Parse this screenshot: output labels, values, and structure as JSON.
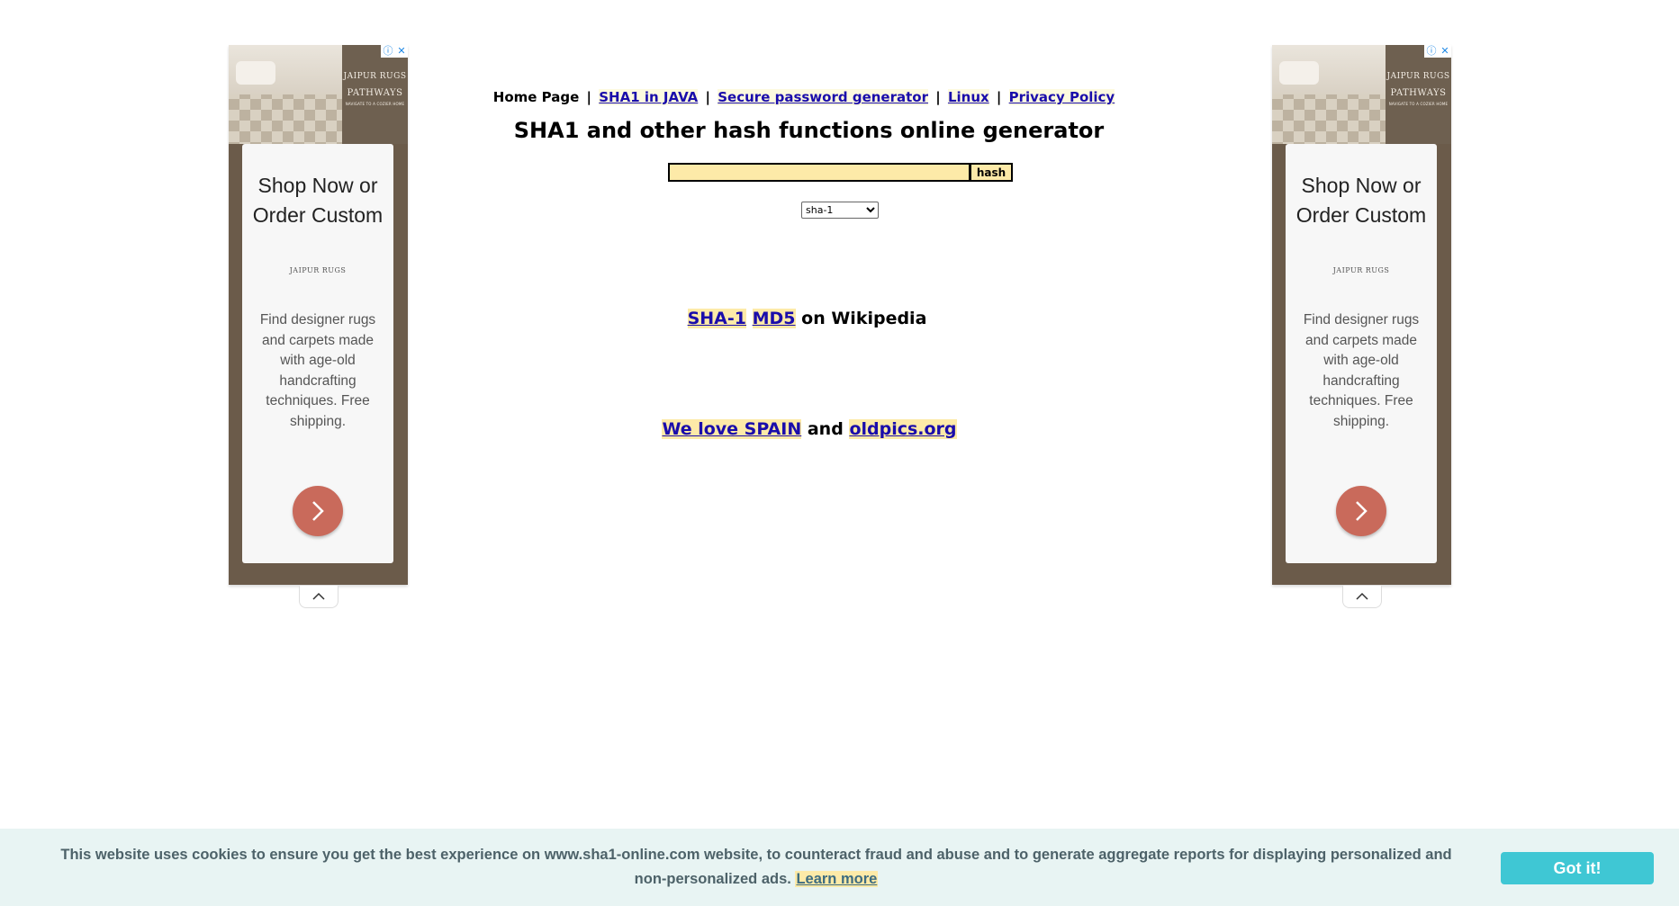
{
  "nav": {
    "home": "Home Page",
    "sep": "|",
    "links": [
      "SHA1 in JAVA",
      "Secure password generator",
      "Linux",
      "Privacy Policy"
    ]
  },
  "title": "SHA1 and other hash functions online generator",
  "form": {
    "input_value": "",
    "button_label": "hash",
    "select_value": "sha-1"
  },
  "wiki": {
    "links": [
      "SHA-1",
      "MD5"
    ],
    "suffix": "on Wikipedia"
  },
  "promo": {
    "link1": "We love SPAIN",
    "conj": "and",
    "link2": "oldpics.org"
  },
  "ad": {
    "brand_small": "JAIPUR RUGS",
    "brand_big": "PATHWAYS",
    "brand_tiny": "NAVIGATE TO A COZIER HOME",
    "adchoices_icon": "info-icon",
    "close_icon": "close-icon",
    "headline": "Shop Now or Order Custom",
    "logo": "JAIPUR RUGS",
    "description": "Find designer rugs and carpets made with age-old handcrafting techniques. Free shipping.",
    "cta_icon": "chevron-right-icon",
    "collapse_icon": "chevron-up-icon",
    "cta_color": "#c96a5b",
    "panel_color": "#6b5b4a"
  },
  "cookie": {
    "text": "This website uses cookies to ensure you get the best experience on www.sha1-online.com website, to counteract fraud and abuse and to generate aggregate reports for displaying personalized and non-personalized ads.",
    "learn_more": "Learn more",
    "button": "Got it!",
    "button_color": "#3fc7d4",
    "bar_color": "#e8f4f3"
  }
}
